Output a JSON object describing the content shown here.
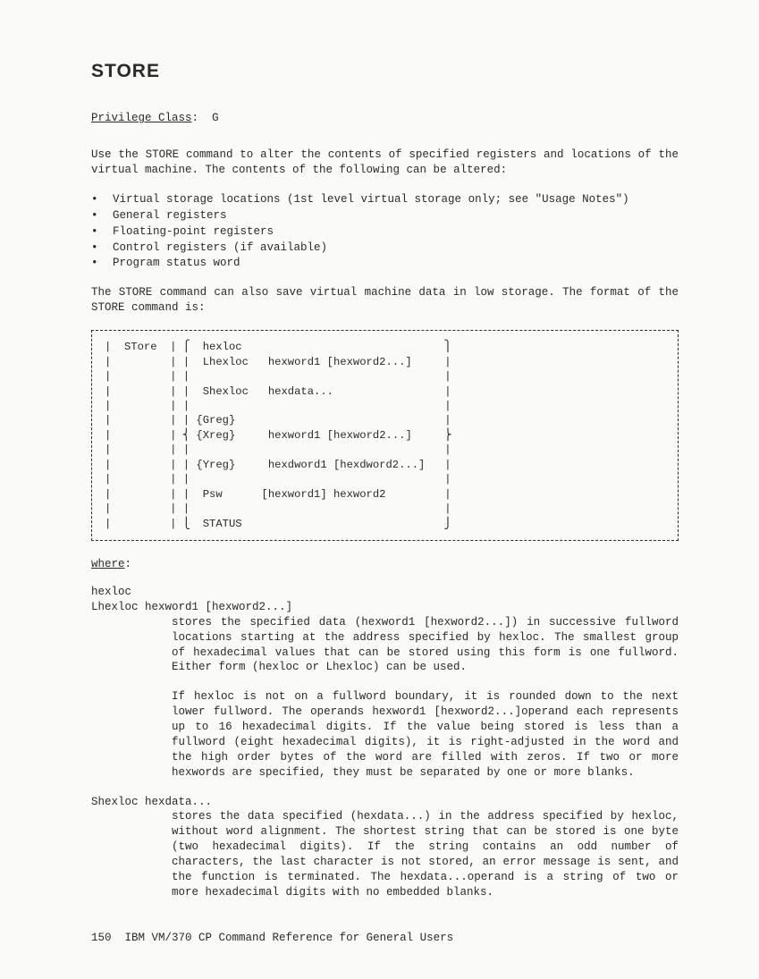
{
  "title": "STORE",
  "privilege": {
    "label": "Privilege Class",
    "sep": ": ",
    "value": "G"
  },
  "intro": "Use the STORE  command to alter the contents of  specified registers and locations of the virtual machine.  The  contents of the following can be altered:",
  "bullets": [
    "Virtual storage locations (1st level virtual storage only; see \"Usage Notes\")",
    "General registers",
    "Floating-point registers",
    "Control registers (if available)",
    "Program status word"
  ],
  "para2": "The STORE  command can also  save virtual  machine data in  low storage. The format of the STORE command is:",
  "syntax": "|  STore  | ⎧  hexloc                               ⎫\n|         | |  Lhexloc   hexword1 [hexword2...]     |\n|         | |                                       |\n|         | |  Shexloc   hexdata...                 |\n|         | |                                       |\n|         | | {Greg}                                |\n|         | ⎨ {Xreg}     hexword1 [hexword2...]     ⎬\n|         | |                                       |\n|         | | {Yreg}     hexdword1 [hexdword2...]   |\n|         | |                                       |\n|         | |  Psw      [hexword1] hexword2         |\n|         | |                                       |\n|         | ⎩  STATUS                               ⎭",
  "where": "where",
  "def1_h1": "hexloc",
  "def1_h2": "Lhexloc  hexword1 [hexword2...]",
  "def1_p1": "stores  the   specified  data   (hexword1  [hexword2...])   in successive  fullword   locations  starting   at  the   address specified by hexloc.  The smallest group of hexadecimal values that can  be stored using this  form is one  fullword.  Either form (hexloc or Lhexloc) can be used.",
  "def1_p2": "If hexloc is not on a fullword boundary, it is rounded down to the   next   lower   fullword.    The   operands    hexword1 [hexword2...]operand  each  represents up  to  16  hexadecimal digits.  If  the value  being stored is  less than  a fullword (eight hexadecimal digits),  it is right-adjusted in  the word and the  high order bytes of  the word are filled  with zeros. If two or more hexwords are  specified, they must be separated by one or more blanks.",
  "def2_h": "Shexloc hexdata...",
  "def2_p": "stores  the   data  specified   (hexdata...)  in   the  address specified  by hexloc,   without  word  alignment.  The  shortest string  that  can  be  stored is  one  byte  (two  hexadecimal digits).  If the string contains  an odd number of characters, the last  character is not stored,  an error message  is sent, and the  function is terminated.   The hexdata...operand  is a string  of two  or more  hexadecimal digits  with no  embedded blanks.",
  "footer": {
    "pagenum": "150",
    "text": "IBM VM/370 CP Command Reference for General Users"
  }
}
